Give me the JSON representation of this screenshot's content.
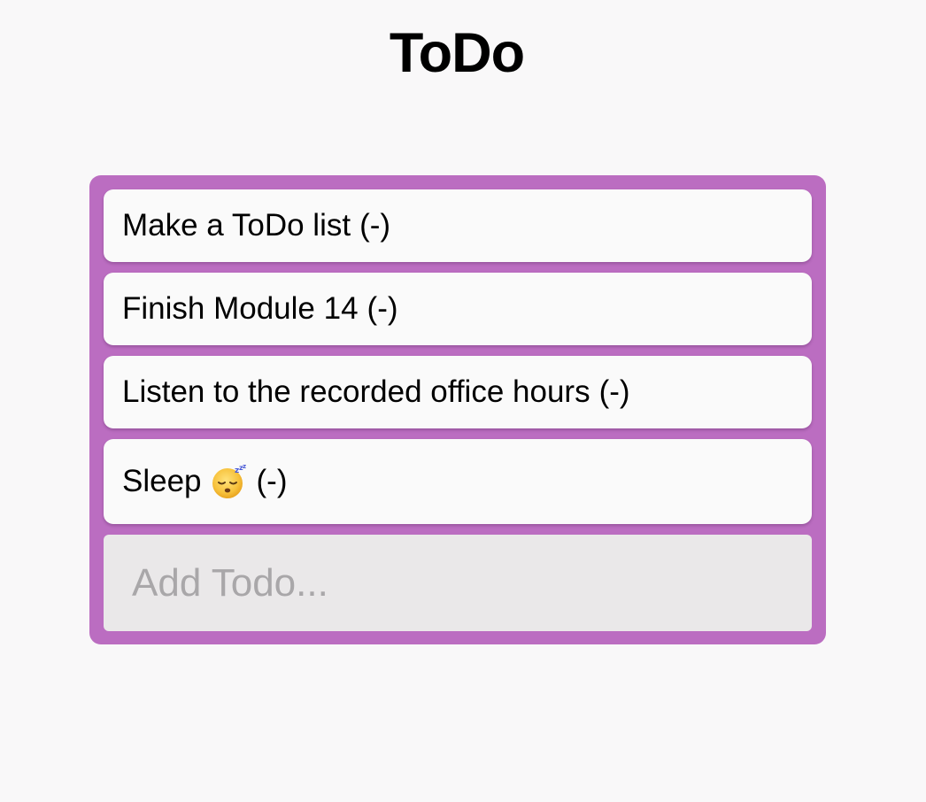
{
  "header": {
    "title": "ToDo"
  },
  "todos": [
    {
      "text": "Make a ToDo list",
      "remove_label": "(-)"
    },
    {
      "text": "Finish Module 14",
      "remove_label": "(-)"
    },
    {
      "text": "Listen to the recorded office hours",
      "remove_label": "(-)"
    },
    {
      "text": "Sleep",
      "icon": "sleeping-face-icon",
      "remove_label": "(-)"
    }
  ],
  "add_todo": {
    "placeholder": "Add Todo...",
    "value": ""
  },
  "colors": {
    "background": "#f9f8f9",
    "panel": "#bb6dc1",
    "item": "#fafafa",
    "input": "#eae8e9",
    "placeholder": "#a9a7a9"
  }
}
